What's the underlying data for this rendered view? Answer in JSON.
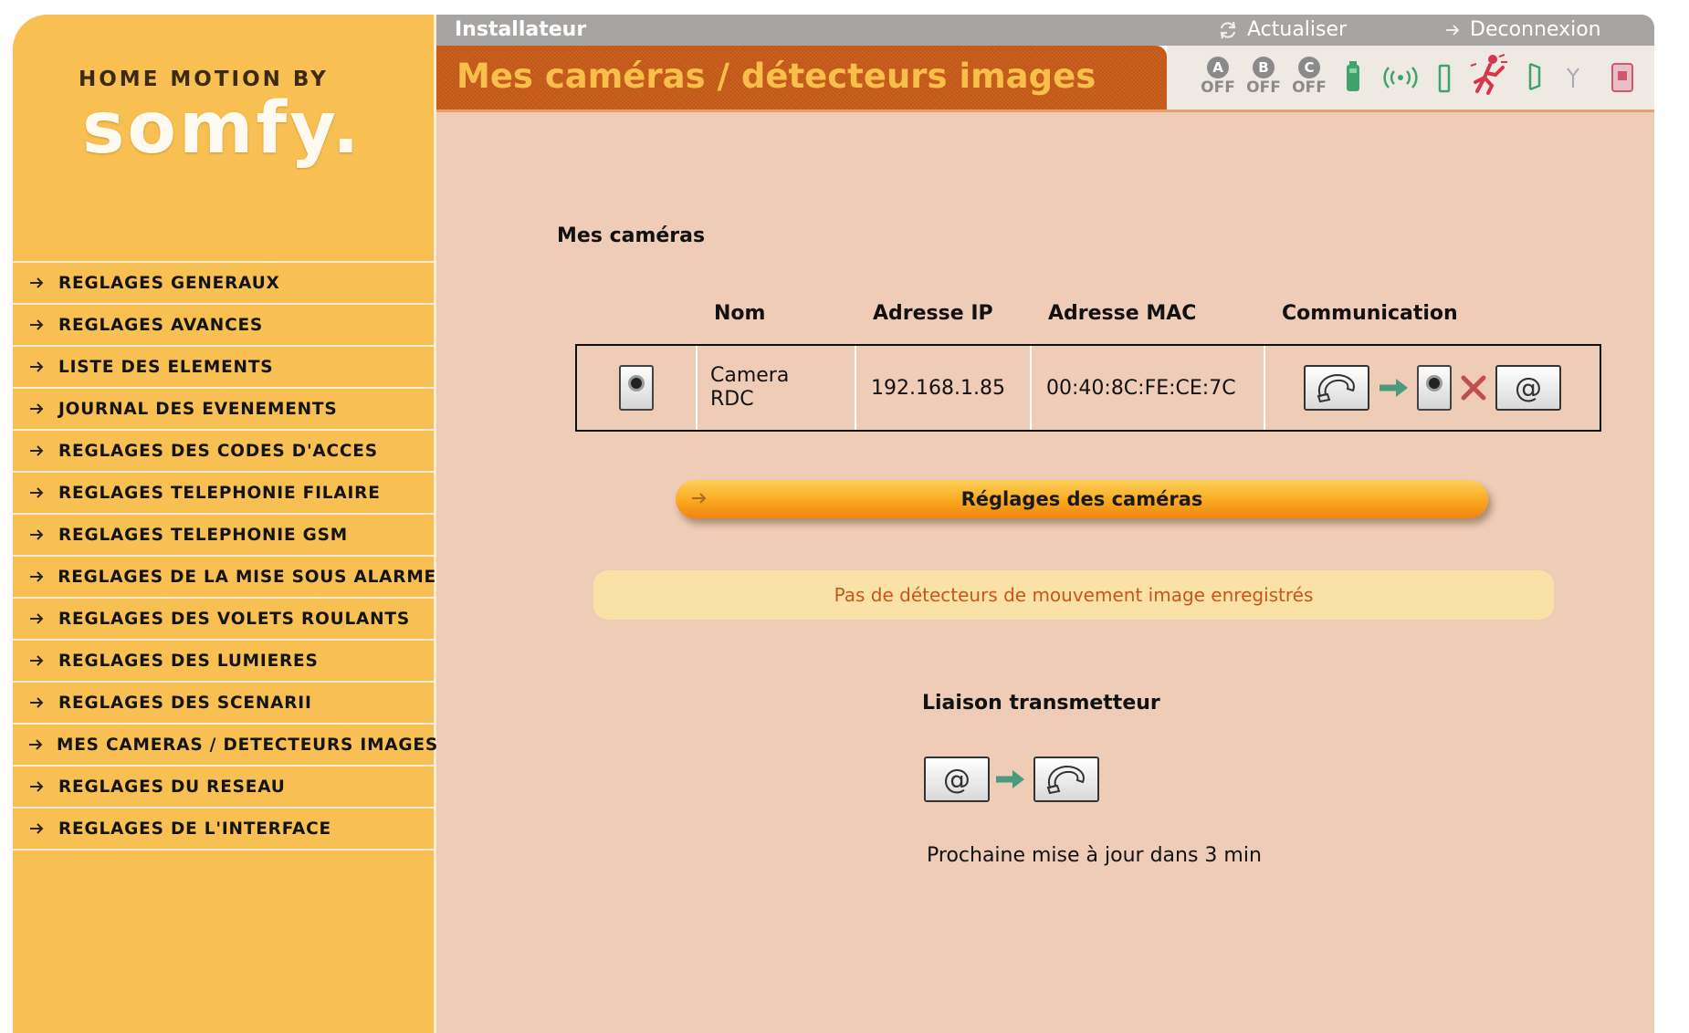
{
  "brand": {
    "by_text": "HOME MOTION BY",
    "name": "somfy."
  },
  "menu": [
    {
      "label": "REGLAGES GENERAUX"
    },
    {
      "label": "REGLAGES AVANCES"
    },
    {
      "label": "LISTE DES ELEMENTS"
    },
    {
      "label": "JOURNAL DES EVENEMENTS"
    },
    {
      "label": "REGLAGES DES CODES D'ACCES"
    },
    {
      "label": "REGLAGES TELEPHONIE FILAIRE"
    },
    {
      "label": "REGLAGES TELEPHONIE GSM"
    },
    {
      "label": "REGLAGES DE LA MISE SOUS ALARME"
    },
    {
      "label": "REGLAGES DES VOLETS ROULANTS"
    },
    {
      "label": "REGLAGES DES LUMIERES"
    },
    {
      "label": "REGLAGES DES SCENARII"
    },
    {
      "label": "MES CAMERAS / DETECTEURS IMAGES"
    },
    {
      "label": "REGLAGES DU RESEAU"
    },
    {
      "label": "REGLAGES DE L'INTERFACE"
    }
  ],
  "topbar": {
    "role": "Installateur",
    "refresh": "Actualiser",
    "logout": "Deconnexion"
  },
  "page_title": "Mes caméras / détecteurs images",
  "status_bar": {
    "zones": [
      {
        "letter": "A",
        "state": "OFF"
      },
      {
        "letter": "B",
        "state": "OFF"
      },
      {
        "letter": "C",
        "state": "OFF"
      }
    ],
    "icons": [
      "battery-icon",
      "radio-signal-icon",
      "door-sensor-icon",
      "intrusion-alert-icon",
      "door-open-icon",
      "antenna-icon",
      "alarm-panel-icon"
    ]
  },
  "cameras_section": {
    "title": "Mes caméras",
    "columns": [
      "Nom",
      "Adresse IP",
      "Adresse MAC",
      "Communication"
    ],
    "rows": [
      {
        "name_line1": "Camera",
        "name_line2": "RDC",
        "ip": "192.168.1.85",
        "mac": "00:40:8C:FE:CE:7C"
      }
    ],
    "at_symbol": "@",
    "settings_button": "Réglages des caméras"
  },
  "notice": "Pas de détecteurs de mouvement image enregistrés",
  "transmitter": {
    "title": "Liaison transmetteur",
    "at_symbol": "@",
    "next_update": "Prochaine mise à jour dans 3 min"
  },
  "colors": {
    "sidebar_bg": "#f8c052",
    "main_bg": "#eeccb6",
    "banner_bg": "#c75a17",
    "title_text": "#f9bf4b",
    "notice_text": "#c8561b",
    "accent_green": "#4a9a7e"
  }
}
